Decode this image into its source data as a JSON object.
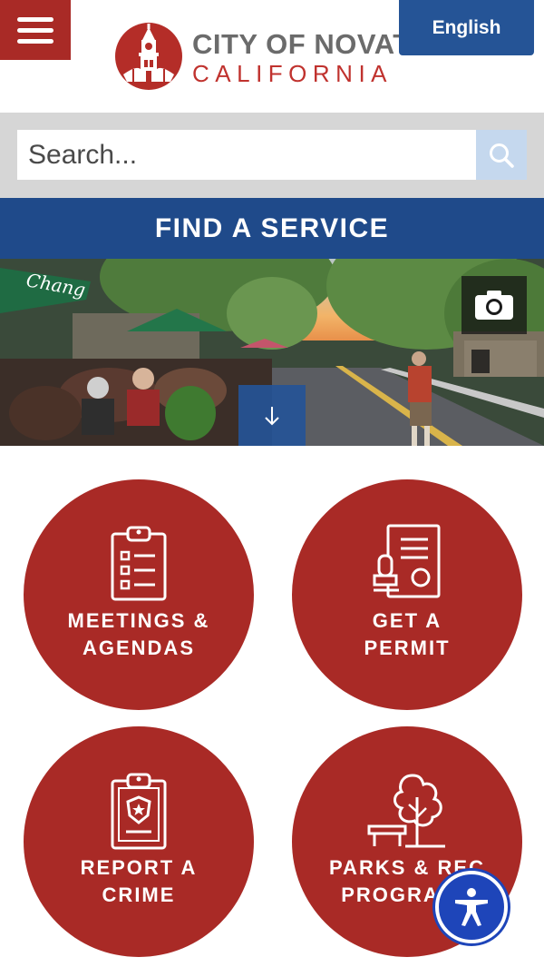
{
  "header": {
    "menu_label": "Menu",
    "language_label": "English",
    "logo_line1": "CITY OF NOVATO",
    "logo_line2": "CALIFORNIA"
  },
  "search": {
    "placeholder": "Search..."
  },
  "find_service": {
    "label": "FIND A SERVICE"
  },
  "hero": {
    "camera_icon": "camera-icon",
    "scroll_icon": "arrow-down-icon",
    "umbrella_text": "Chang"
  },
  "services": [
    {
      "line1": "MEETINGS &",
      "line2": "AGENDAS",
      "icon": "clipboard-list-icon"
    },
    {
      "line1": "GET A",
      "line2": "PERMIT",
      "icon": "permit-stamp-icon"
    },
    {
      "line1": "REPORT A",
      "line2": "CRIME",
      "icon": "police-badge-clipboard-icon"
    },
    {
      "line1": "PARKS & REC",
      "line2": "PROGRAMS",
      "icon": "tree-bench-icon"
    }
  ],
  "accessibility": {
    "icon": "accessibility-icon"
  },
  "colors": {
    "brand_red": "#a92a26",
    "brand_blue": "#1f4a8a",
    "accessibility_blue": "#1e45b9"
  }
}
